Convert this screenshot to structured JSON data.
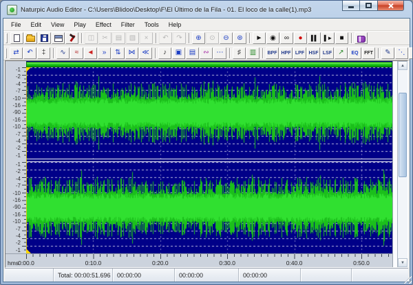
{
  "window": {
    "title": "Naturpic Audio Editor - C:\\Users\\Blidoo\\Desktop\\F\\El Último de la Fila - 01. El loco de la calle(1).mp3",
    "controls": [
      {
        "name": "minimize-button",
        "shape": "win-min"
      },
      {
        "name": "maximize-button",
        "shape": "win-max"
      },
      {
        "name": "close-button",
        "shape": "win-close",
        "cls": "close"
      }
    ]
  },
  "menu": {
    "items": [
      "File",
      "Edit",
      "View",
      "Play",
      "Effect",
      "Filter",
      "Tools",
      "Help"
    ]
  },
  "toolbar1": [
    {
      "name": "new-button",
      "shape": "page"
    },
    {
      "name": "open-button",
      "shape": "folder"
    },
    {
      "name": "save-button",
      "shape": "floppy"
    },
    {
      "name": "file-properties-button",
      "shape": "window"
    },
    {
      "name": "batch-tool-button",
      "shape": "hammer"
    },
    {
      "sep": true
    },
    {
      "name": "copy-button",
      "glyph": "◫",
      "color": "#555",
      "enabled": false
    },
    {
      "name": "cut-button",
      "glyph": "✂",
      "color": "#555",
      "enabled": false
    },
    {
      "name": "paste-button",
      "glyph": "▤",
      "color": "#555",
      "enabled": false
    },
    {
      "name": "trim-button",
      "glyph": "▧",
      "color": "#555",
      "enabled": false
    },
    {
      "name": "delete-button",
      "glyph": "×",
      "color": "#555",
      "enabled": false
    },
    {
      "sep": true
    },
    {
      "name": "undo-button",
      "glyph": "↶",
      "color": "#555",
      "enabled": false
    },
    {
      "name": "redo-button",
      "glyph": "↷",
      "color": "#555",
      "enabled": false
    },
    {
      "sep": true
    },
    {
      "name": "zoom-in-button",
      "glyph": "⊕",
      "color": "#1a3cc4"
    },
    {
      "name": "zoom-selection-button",
      "glyph": "⊙",
      "color": "#555",
      "enabled": false
    },
    {
      "name": "zoom-out-button",
      "glyph": "⊖",
      "color": "#1a3cc4"
    },
    {
      "name": "zoom-full-button",
      "glyph": "⊛",
      "color": "#1a3cc4"
    },
    {
      "sep": true
    },
    {
      "name": "play-button",
      "glyph": "►",
      "color": "#111"
    },
    {
      "name": "play-all-button",
      "glyph": "◉",
      "color": "#111"
    },
    {
      "name": "loop-button",
      "glyph": "∞",
      "color": "#111"
    },
    {
      "name": "record-button",
      "glyph": "●",
      "color": "#d00000"
    },
    {
      "name": "pause-button",
      "glyph": "▌▌",
      "color": "#111"
    },
    {
      "name": "play-pause-button",
      "glyph": "▌►",
      "color": "#111"
    },
    {
      "name": "stop-button",
      "glyph": "■",
      "color": "#111"
    },
    {
      "sep": true
    },
    {
      "name": "help-button",
      "shape": "book"
    }
  ],
  "toolbar2": [
    {
      "name": "selection-arrows-button",
      "glyph": "⇄",
      "color": "#1a3cc4"
    },
    {
      "name": "restore-view-button",
      "glyph": "↶",
      "color": "#1a3cc4"
    },
    {
      "name": "cursor-marker-button",
      "glyph": "‡",
      "color": "#333"
    },
    {
      "sep": true
    },
    {
      "name": "amplify-button",
      "glyph": "∿",
      "color": "#223a8c"
    },
    {
      "name": "normalize-button",
      "glyph": "≈",
      "color": "#aa1111"
    },
    {
      "name": "fade-in-button",
      "glyph": "◄",
      "color": "#cc2222"
    },
    {
      "name": "fade-out-button",
      "glyph": "»",
      "color": "#1a3cc4"
    },
    {
      "name": "stretch-button",
      "glyph": "⇅",
      "color": "#1a3cc4"
    },
    {
      "name": "crossfade-button",
      "glyph": "⋈",
      "color": "#1a3cc4"
    },
    {
      "name": "echo-button",
      "glyph": "≪",
      "color": "#1a3cc4"
    },
    {
      "sep": true
    },
    {
      "name": "sound-effects-button",
      "glyph": "♪",
      "color": "#333"
    },
    {
      "name": "mix-window-button",
      "glyph": "▣",
      "color": "#1a3cc4"
    },
    {
      "name": "mix-paste-button",
      "glyph": "▤",
      "color": "#1a3cc4"
    },
    {
      "name": "reverse-button",
      "glyph": "∾",
      "color": "#a020a0"
    },
    {
      "name": "silence-button",
      "glyph": "⋯",
      "color": "#1a3cc4"
    },
    {
      "sep": true
    },
    {
      "name": "insert-marker-button",
      "glyph": "♯",
      "color": "#333"
    },
    {
      "name": "level-meter-button",
      "glyph": "▥",
      "color": "#2a8a2a"
    },
    {
      "sep": true
    },
    {
      "name": "bpf-button",
      "text": "BPF"
    },
    {
      "name": "hpf-button",
      "text": "HPF"
    },
    {
      "name": "lpf-button",
      "text": "LPF"
    },
    {
      "name": "hsf-button",
      "text": "HSF"
    },
    {
      "name": "lsf-button",
      "text": "LSF"
    },
    {
      "name": "graph-filter-button",
      "glyph": "↗",
      "color": "#2a8a2a"
    },
    {
      "name": "eq-button",
      "text": "EQ",
      "color": "#1a3cc4"
    },
    {
      "name": "fft-button",
      "text": "FFT",
      "color": "#222"
    },
    {
      "sep": true
    },
    {
      "name": "edit-sample-button",
      "glyph": "✎",
      "color": "#223a8c"
    },
    {
      "name": "noise-reduction-button",
      "glyph": "⋱",
      "color": "#1a3cc4"
    },
    {
      "name": "draw-wave-button",
      "glyph": "✎",
      "color": "#555"
    }
  ],
  "editor": {
    "db_labels": [
      "-1",
      "-2",
      "-4",
      "-7",
      "-10",
      "-16",
      "-90",
      "-16",
      "-10",
      "-7",
      "-4",
      "-2",
      "-1"
    ],
    "timeline": {
      "unit_label": "hms",
      "ticks": [
        "0:00.0",
        "0:10.0",
        "0:20.0",
        "0:30.0",
        "0:40.0",
        "0:50.0"
      ]
    },
    "waveform": {
      "bg": "#000088",
      "wave_color": "#1bbf1b",
      "core_color": "#30e030",
      "grid_color": "#ffffff",
      "overview_bar_color": "#14c214",
      "cursor_color": "#ffd800"
    },
    "scrollbar": {
      "up_glyph": "▲",
      "down_glyph": "▼"
    }
  },
  "statusbar": {
    "panels": [
      "",
      "Total: 00:00:51.696",
      "00:00:00",
      "00:00:00",
      "00:00:00",
      "",
      ""
    ]
  }
}
